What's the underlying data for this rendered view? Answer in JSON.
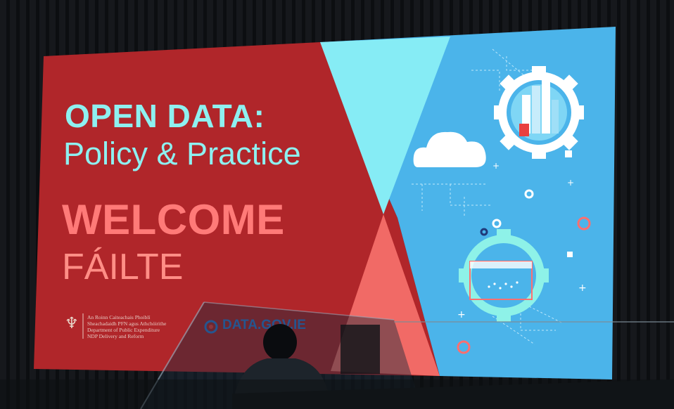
{
  "slide": {
    "heading_line1": "OPEN DATA:",
    "heading_line2": "Policy & Practice",
    "welcome_en": "WELCOME",
    "welcome_ga": "FÁILTE",
    "dept_lines": [
      "An Roinn Caiteachais Phoiblí",
      "Sheachadaidh PFN agus Athchóirithe",
      "Department of Public Expenditure",
      "NDP Delivery and Reform"
    ],
    "site": "DATA.GOV.IE"
  },
  "colors": {
    "red_panel": "#b0262a",
    "cyan": "#8ef0f0",
    "blue": "#49b3ea",
    "coral": "#ff7a78"
  },
  "icons": [
    "harp-icon",
    "cloud-icon",
    "gear-chart-icon",
    "gear-folder-icon",
    "datagov-logo-icon"
  ]
}
